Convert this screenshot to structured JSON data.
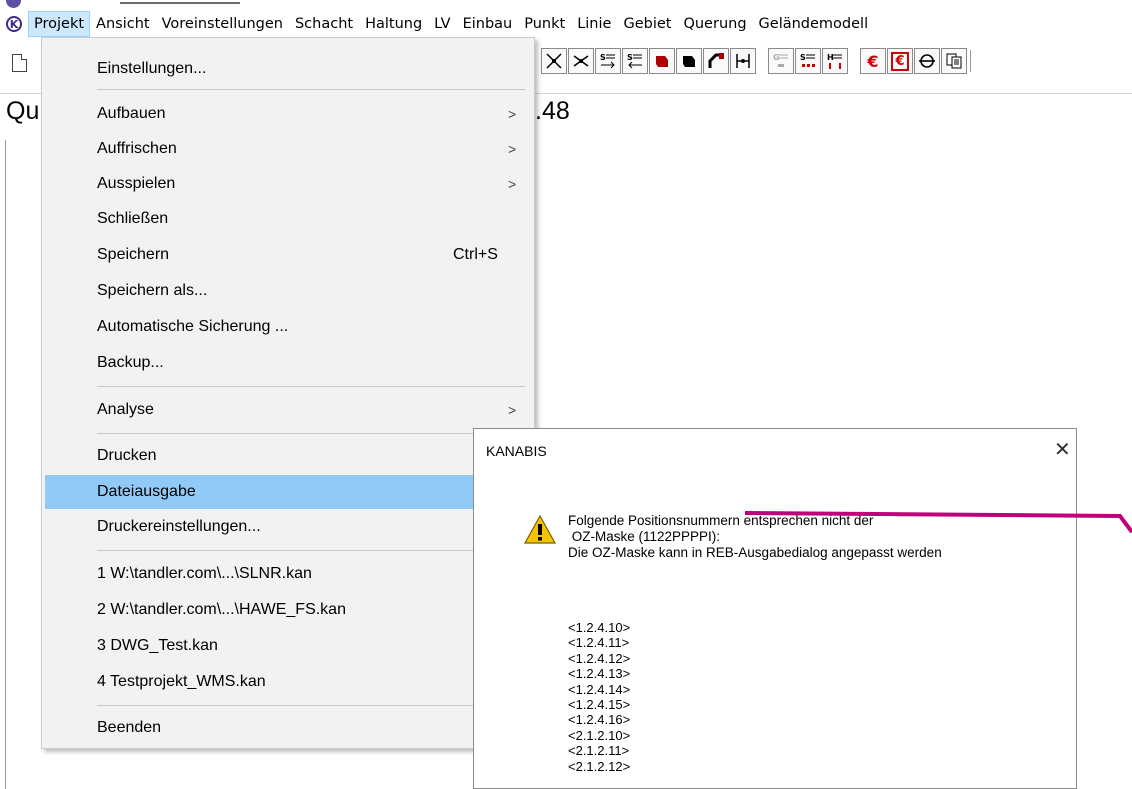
{
  "app_icon": "K",
  "menubar": {
    "items": [
      "Projekt",
      "Ansicht",
      "Voreinstellungen",
      "Schacht",
      "Haltung",
      "LV",
      "Einbau",
      "Punkt",
      "Linie",
      "Gebiet",
      "Querung",
      "Geländemodell"
    ]
  },
  "toolbar": {
    "buttons": [
      "new-doc-icon",
      "node-cross-icon",
      "node-cross-alt-icon",
      "s-list-right-icon",
      "s-list-left-icon",
      "red-shape-icon",
      "black-shape-icon",
      "pipe-corner-icon",
      "h-junction-icon",
      "g-list-gray-icon",
      "s-list-red-dots-icon",
      "h-list-red-icon",
      "euro-icon",
      "euro-boxed-icon",
      "pipe-section-icon",
      "copy-doc-icon"
    ]
  },
  "canvas": {
    "text_left": "Qu",
    "text_right": ".48"
  },
  "project_menu": {
    "items": [
      {
        "label": "Einstellungen...",
        "shortcut": "",
        "submenu": false
      },
      {
        "label": "Aufbauen",
        "shortcut": "",
        "submenu": true
      },
      {
        "label": "Auffrischen",
        "shortcut": "",
        "submenu": true
      },
      {
        "label": "Ausspielen",
        "shortcut": "",
        "submenu": true
      },
      {
        "label": "Schließen",
        "shortcut": "",
        "submenu": false
      },
      {
        "label": "Speichern",
        "shortcut": "Ctrl+S",
        "submenu": false
      },
      {
        "label": "Speichern als...",
        "shortcut": "",
        "submenu": false
      },
      {
        "label": "Automatische Sicherung ...",
        "shortcut": "",
        "submenu": false
      },
      {
        "label": "Backup...",
        "shortcut": "",
        "submenu": false
      },
      {
        "label": "Analyse",
        "shortcut": "",
        "submenu": true
      },
      {
        "label": "Drucken",
        "shortcut": "",
        "submenu": false
      },
      {
        "label": "Dateiausgabe",
        "shortcut": "",
        "submenu": false,
        "highlighted": true
      },
      {
        "label": "Druckereinstellungen...",
        "shortcut": "",
        "submenu": false
      },
      {
        "label": "1 W:\\tandler.com\\...\\SLNR.kan",
        "shortcut": "",
        "submenu": false
      },
      {
        "label": "2 W:\\tandler.com\\...\\HAWE_FS.kan",
        "shortcut": "",
        "submenu": false
      },
      {
        "label": "3 DWG_Test.kan",
        "shortcut": "",
        "submenu": false
      },
      {
        "label": "4 Testprojekt_WMS.kan",
        "shortcut": "",
        "submenu": false
      },
      {
        "label": "Beenden",
        "shortcut": "",
        "submenu": false
      }
    ],
    "submenu_arrow": ">"
  },
  "dialog": {
    "title": "KANABIS",
    "close_glyph": "✕",
    "message_line1": "Folgende Positionsnummern entsprechen nicht der",
    "message_line2": " OZ-Maske (1122PPPPI):",
    "message_line3": "Die OZ-Maske kann in REB-Ausgabedialog angepasst werden",
    "positions": [
      "<1.2.4.10>",
      "<1.2.4.11>",
      "<1.2.4.12>",
      "<1.2.4.13>",
      "<1.2.4.14>",
      "<1.2.4.15>",
      "<1.2.4.16>",
      "<2.1.2.10>",
      "<2.1.2.11>",
      "<2.1.2.12>"
    ],
    "icon": "warning-icon"
  },
  "colors": {
    "menu_highlight": "#91c9f7",
    "menubar_active": "#cce8ff",
    "annotation": "#c0007a",
    "warning": "#f5c400"
  }
}
